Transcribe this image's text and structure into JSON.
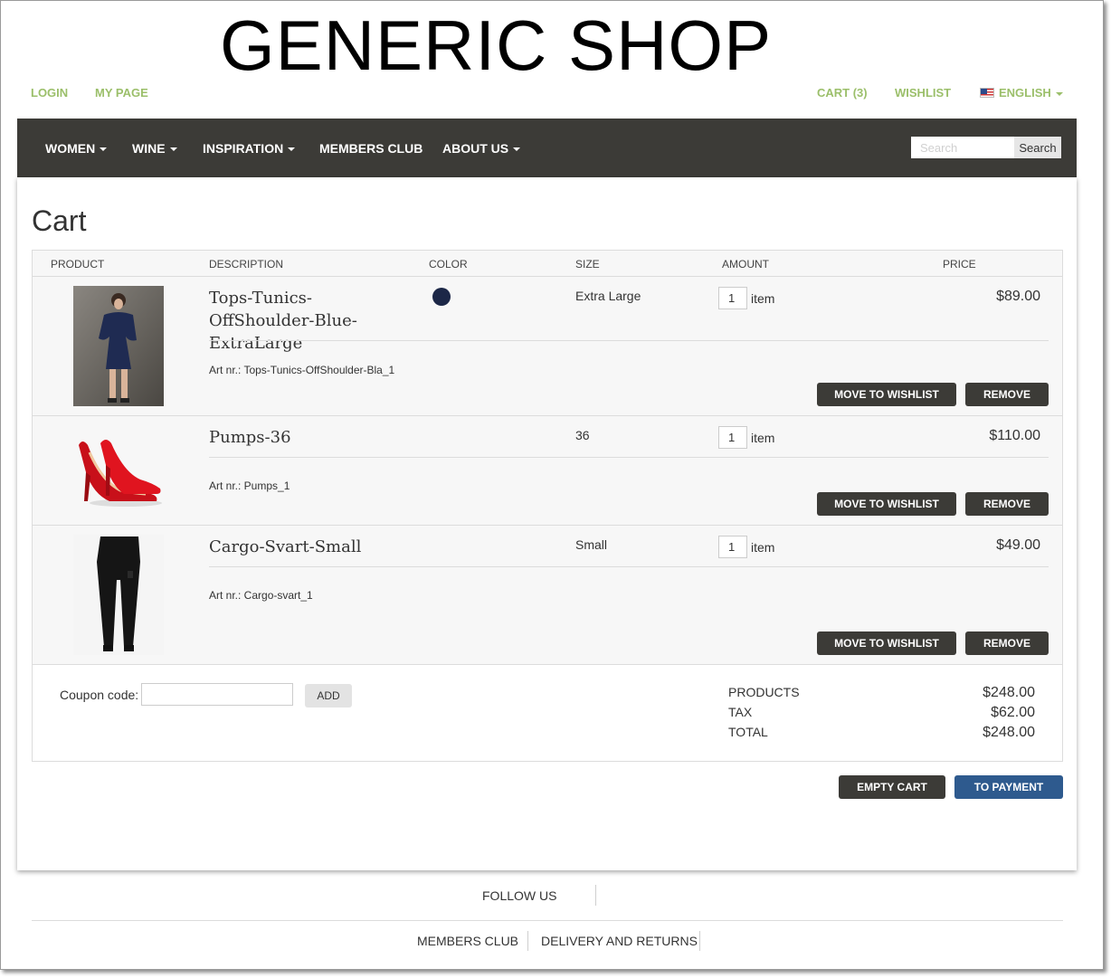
{
  "header": {
    "logo": "GENERIC SHOP",
    "login": "LOGIN",
    "my_page": "MY PAGE",
    "cart": "CART (3)",
    "wishlist": "WISHLIST",
    "language": "ENGLISH"
  },
  "nav": {
    "items": [
      {
        "label": "WOMEN",
        "dropdown": true
      },
      {
        "label": "WINE",
        "dropdown": true
      },
      {
        "label": "INSPIRATION",
        "dropdown": true
      },
      {
        "label": "MEMBERS CLUB",
        "dropdown": false
      },
      {
        "label": "ABOUT US",
        "dropdown": true
      }
    ],
    "search_placeholder": "Search",
    "search_button": "Search"
  },
  "page": {
    "title": "Cart"
  },
  "cart": {
    "columns": [
      "PRODUCT",
      "DESCRIPTION",
      "COLOR",
      "SIZE",
      "AMOUNT",
      "PRICE"
    ],
    "items": [
      {
        "name": "Tops-Tunics-OffShoulder-Blue-ExtraLarge",
        "art_nr": "Art nr.: Tops-Tunics-OffShoulder-Bla_1",
        "color": "#1c2747",
        "size": "Extra Large",
        "quantity": "1",
        "unit": "item",
        "price": "$89.00"
      },
      {
        "name": "Pumps-36",
        "art_nr": "Art nr.: Pumps_1",
        "size": "36",
        "quantity": "1",
        "unit": "item",
        "price": "$110.00"
      },
      {
        "name": "Cargo-Svart-Small",
        "art_nr": "Art nr.: Cargo-svart_1",
        "size": "Small",
        "quantity": "1",
        "unit": "item",
        "price": "$49.00"
      }
    ],
    "move_to_wishlist": "MOVE TO WISHLIST",
    "remove": "REMOVE"
  },
  "summary": {
    "coupon_label": "Coupon code:",
    "coupon_value": "",
    "add_button": "ADD",
    "products_label": "PRODUCTS",
    "products_value": "$248.00",
    "tax_label": "TAX",
    "tax_value": "$62.00",
    "total_label": "TOTAL",
    "total_value": "$248.00"
  },
  "actions": {
    "empty_cart": "EMPTY CART",
    "to_payment": "TO PAYMENT"
  },
  "footer": {
    "follow_us": "FOLLOW US",
    "links": [
      "MEMBERS CLUB",
      "DELIVERY AND RETURNS"
    ]
  },
  "colors": {
    "accent_green": "#9bbf6a",
    "nav_bg": "#3c3b37",
    "payment_blue": "#2e5a8e"
  }
}
